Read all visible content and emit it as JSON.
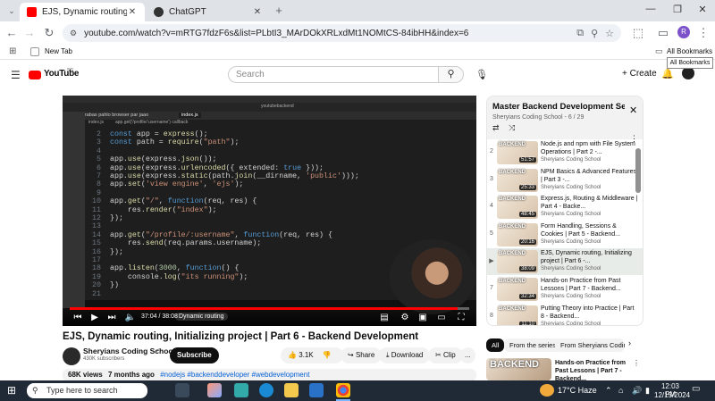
{
  "browser": {
    "tabs": [
      {
        "title": "EJS, Dynamic routing, Initializing",
        "active": true
      },
      {
        "title": "ChatGPT",
        "active": false
      }
    ],
    "url": "youtube.com/watch?v=mRTG7fdzF6s&list=PLbtI3_MArDOkXRLxdMt1NOMtCS-84ibHH&index=6",
    "new_tab_bookmark": "New Tab",
    "all_bookmarks": "All Bookmarks",
    "all_bookmarks_tooltip": "All Bookmarks",
    "profile_initial": "R"
  },
  "youtube": {
    "logo": "YouTube",
    "country": "SG",
    "search_placeholder": "Search",
    "create_label": "Create"
  },
  "video": {
    "title": "EJS, Dynamic routing, Initializing project | Part 6 - Backend Development",
    "time_display": "37:04 / 38:08",
    "chapter_label": "Dynamic routing",
    "progress_fraction": 0.972,
    "inner_window": {
      "tab1": "zabas pahlo browser par jaao",
      "tab2": "index.js",
      "tab2_file": "index.js",
      "breadcrumb_file": "app.get('/profile/:username') callback",
      "address": "youtubebackend"
    },
    "code_lines": [
      {
        "n": "2",
        "code": "const app = express();"
      },
      {
        "n": "3",
        "code": "const path = require(\"path\");"
      },
      {
        "n": "4",
        "code": ""
      },
      {
        "n": "5",
        "code": "app.use(express.json());"
      },
      {
        "n": "6",
        "code": "app.use(express.urlencoded({ extended: true }));"
      },
      {
        "n": "7",
        "code": "app.use(express.static(path.join(__dirname, 'public')));"
      },
      {
        "n": "8",
        "code": "app.set('view engine', 'ejs');"
      },
      {
        "n": "9",
        "code": ""
      },
      {
        "n": "10",
        "code": "app.get(\"/\", function(req, res) {"
      },
      {
        "n": "11",
        "code": "    res.render(\"index\");"
      },
      {
        "n": "12",
        "code": "});"
      },
      {
        "n": "13",
        "code": ""
      },
      {
        "n": "14",
        "code": "app.get(\"/profile/:username\", function(req, res) {"
      },
      {
        "n": "15",
        "code": "    res.send(req.params.username);"
      },
      {
        "n": "16",
        "code": "});"
      },
      {
        "n": "17",
        "code": ""
      },
      {
        "n": "18",
        "code": "app.listen(3000, function() {"
      },
      {
        "n": "19",
        "code": "    console.log(\"its running\");"
      },
      {
        "n": "20",
        "code": "})"
      },
      {
        "n": "21",
        "code": ""
      }
    ]
  },
  "channel": {
    "name": "Sheryians Coding School",
    "subscribers": "430K subscribers",
    "subscribe_label": "Subscribe"
  },
  "actions": {
    "likes": "3.1K",
    "share": "Share",
    "download": "Download",
    "clip": "Clip",
    "more": "..."
  },
  "description": {
    "views": "68K views",
    "age": "7 months ago",
    "tags": "#nodejs #backenddeveloper #webdevelopment"
  },
  "playlist": {
    "title": "Master Backend Development Serie...",
    "meta": "Sheryians Coding School - 6 / 29",
    "items": [
      {
        "idx": "2",
        "title": "Node.js and npm with File System Operations | Part 2 -...",
        "channel": "Sheryians Coding School",
        "duration": "51:57",
        "current": false
      },
      {
        "idx": "3",
        "title": "NPM Basics & Advanced Features | Part 3 -...",
        "channel": "Sheryians Coding School",
        "duration": "25:33",
        "current": false
      },
      {
        "idx": "4",
        "title": "Express.js, Routing & Middleware | Part 4 - Backe...",
        "channel": "Sheryians Coding School",
        "duration": "48:45",
        "current": false
      },
      {
        "idx": "5",
        "title": "Form Handling, Sessions & Cookies | Part 5 - Backend...",
        "channel": "Sheryians Coding School",
        "duration": "20:16",
        "current": false
      },
      {
        "idx": "▶",
        "title": "EJS, Dynamic routing, Initializing project | Part 6 -...",
        "channel": "Sheryians Coding School",
        "duration": "38:09",
        "current": true
      },
      {
        "idx": "7",
        "title": "Hands-on Practice from Past Lessons | Part 7 - Backend...",
        "channel": "Sheryians Coding School",
        "duration": "32:34",
        "current": false
      },
      {
        "idx": "8",
        "title": "Putting Theory into Practice | Part 8 - Backend...",
        "channel": "Sheryians Coding School",
        "duration": "11:10",
        "current": false
      }
    ],
    "thumb_label": "BACKEND"
  },
  "chips": [
    "All",
    "From the series",
    "From Sheryians Coding S"
  ],
  "recommended": {
    "title": "Hands-on Practice from Past Lessons | Part 7 - Backend...",
    "thumb_label": "BACKEND"
  },
  "taskbar": {
    "search_placeholder": "Type here to search",
    "weather": "17°C  Haze",
    "time": "12:03 PM",
    "date": "12/15/2024"
  }
}
